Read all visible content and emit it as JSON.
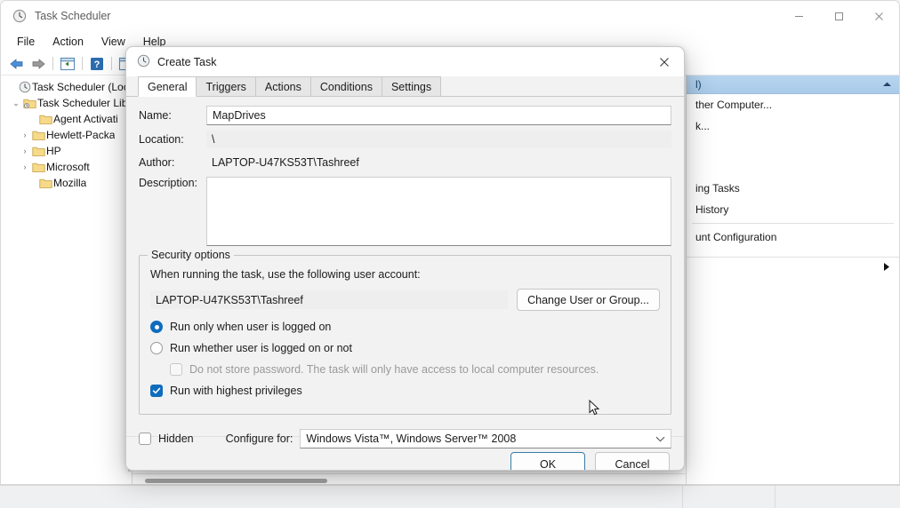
{
  "window": {
    "title": "Task Scheduler",
    "icon": "clock-icon",
    "controls": {
      "minimize": "—",
      "maximize": "□",
      "close": "✕"
    }
  },
  "menubar": {
    "items": [
      "File",
      "Action",
      "View",
      "Help"
    ]
  },
  "toolbar": {
    "items": [
      {
        "name": "back-button",
        "icon": "arrow-left-icon"
      },
      {
        "name": "forward-button",
        "icon": "arrow-right-icon"
      },
      {
        "name": "show-hide-tree-button",
        "icon": "pane-left-icon"
      },
      {
        "name": "help-button",
        "icon": "question-mark-icon"
      },
      {
        "name": "show-hide-actions-button",
        "icon": "pane-right-icon"
      }
    ]
  },
  "tree": {
    "items": [
      {
        "label": "Task Scheduler (Local",
        "icon": "clock-icon",
        "arrow": "",
        "indent": 0
      },
      {
        "label": "Task Scheduler Lib",
        "icon": "folder-clock-icon",
        "arrow": "⌄",
        "indent": 1
      },
      {
        "label": "Agent Activati",
        "icon": "folder-icon",
        "arrow": "",
        "indent": 2
      },
      {
        "label": "Hewlett-Packa",
        "icon": "folder-icon",
        "arrow": "›",
        "indent": 2
      },
      {
        "label": "HP",
        "icon": "folder-icon",
        "arrow": "›",
        "indent": 2
      },
      {
        "label": "Microsoft",
        "icon": "folder-icon",
        "arrow": "›",
        "indent": 2
      },
      {
        "label": "Mozilla",
        "icon": "folder-icon",
        "arrow": "",
        "indent": 2
      }
    ]
  },
  "actions_pane": {
    "header": "l)",
    "collapse_icon": "chevron-up-icon",
    "items": [
      "ther Computer...",
      "k..."
    ],
    "items2": [
      "ing Tasks",
      " History"
    ],
    "items3": [
      "unt Configuration"
    ],
    "expand_icon": "triangle-right-icon"
  },
  "dialog": {
    "title": "Create Task",
    "icon": "clock-icon",
    "close_icon": "close-icon",
    "tabs": [
      {
        "label": "General",
        "active": true
      },
      {
        "label": "Triggers",
        "active": false
      },
      {
        "label": "Actions",
        "active": false
      },
      {
        "label": "Conditions",
        "active": false
      },
      {
        "label": "Settings",
        "active": false
      }
    ],
    "fields": {
      "name_label": "Name:",
      "name_value": "MapDrives",
      "location_label": "Location:",
      "location_value": "\\",
      "author_label": "Author:",
      "author_value": "LAPTOP-U47KS53T\\Tashreef",
      "description_label": "Description:",
      "description_value": ""
    },
    "security": {
      "legend": "Security options",
      "prompt": "When running the task, use the following user account:",
      "account": "LAPTOP-U47KS53T\\Tashreef",
      "change_button": "Change User or Group...",
      "radio_logged_on": "Run only when user is logged on",
      "radio_logged_on_checked": true,
      "radio_whether": "Run whether user is logged on or not",
      "radio_whether_checked": false,
      "checkbox_no_password": "Do not store password.  The task will only have access to local computer resources.",
      "checkbox_no_password_checked": false,
      "checkbox_no_password_disabled": true,
      "checkbox_highest": "Run with highest privileges",
      "checkbox_highest_checked": true
    },
    "footer_config": {
      "hidden_label": "Hidden",
      "hidden_checked": false,
      "configure_for_label": "Configure for:",
      "configure_for_value": "Windows Vista™, Windows Server™ 2008",
      "dropdown_icon": "chevron-down-icon"
    },
    "buttons": {
      "ok": "OK",
      "cancel": "Cancel"
    }
  },
  "colors": {
    "accent": "#0f6cbd",
    "actions_header": "#b8d5ef",
    "dialog_bg": "#f2f2f2",
    "primary_border": "#3a7ca8"
  }
}
